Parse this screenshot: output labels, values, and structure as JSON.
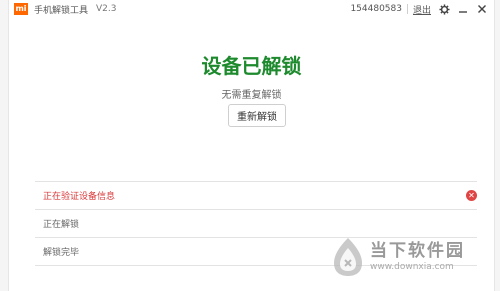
{
  "titlebar": {
    "logo_text": "mi",
    "app_title": "手机解锁工具",
    "version": "V2.3",
    "account": "154480583",
    "logout": "退出",
    "icons": [
      "gear-icon",
      "minimize-icon",
      "close-icon"
    ]
  },
  "main": {
    "status_title": "设备已解锁",
    "status_subtitle": "无需重复解锁",
    "relock_button": "重新解锁"
  },
  "steps": [
    {
      "label": "正在验证设备信息",
      "state": "error"
    },
    {
      "label": "正在解锁",
      "state": "pending"
    },
    {
      "label": "解锁完毕",
      "state": "pending"
    }
  ],
  "watermark": {
    "main": "当下软件园",
    "sub": "www.downxia.com"
  },
  "colors": {
    "success": "#1e8a2e",
    "error": "#d9393a",
    "brand": "#ff6700"
  }
}
